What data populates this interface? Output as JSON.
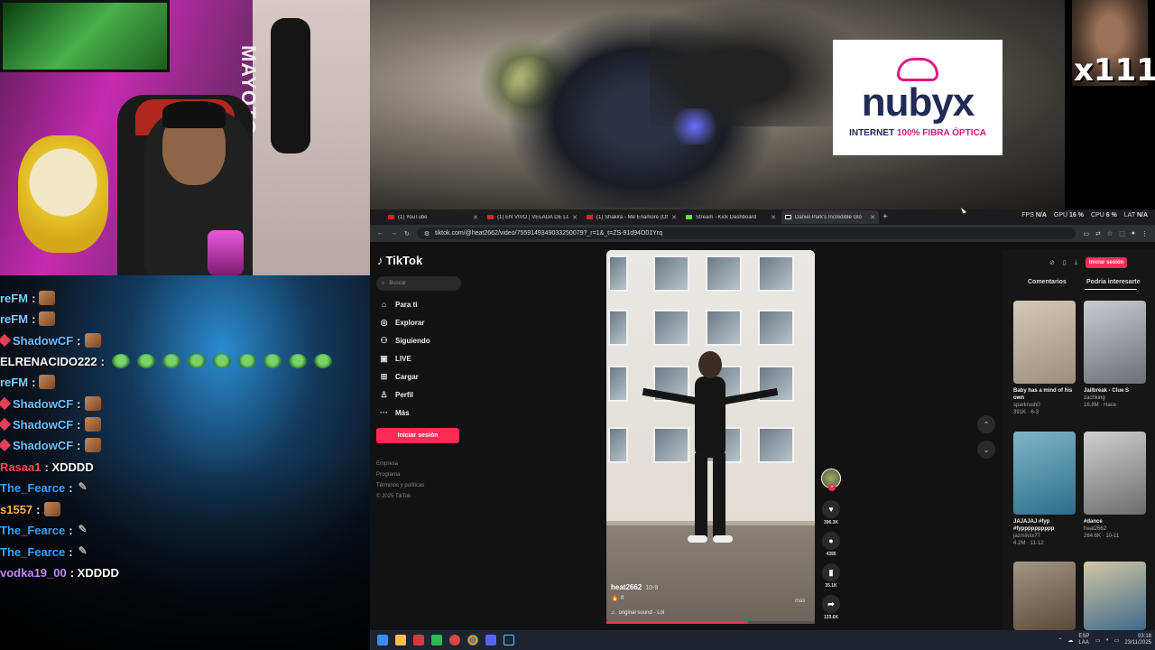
{
  "webcam": {
    "bag_text": "MAYOTO"
  },
  "chat": {
    "lines": [
      {
        "user": "reFM",
        "color": "#7dd0ff",
        "message": ":",
        "emote": "face",
        "badge": false
      },
      {
        "user": "reFM",
        "color": "#7dd0ff",
        "message": ":",
        "emote": "face",
        "badge": false
      },
      {
        "user": "ShadowCF",
        "color": "#6ec0ff",
        "message": ":",
        "emote": "face",
        "badge": true
      },
      {
        "user": "ELRENACIDO222",
        "color": "#ffffff",
        "message": ":",
        "emote": "pepe",
        "badge": false
      },
      {
        "user": "reFM",
        "color": "#7dd0ff",
        "message": ":",
        "emote": "face",
        "badge": false
      },
      {
        "user": "ShadowCF",
        "color": "#6ec0ff",
        "message": ":",
        "emote": "face",
        "badge": true
      },
      {
        "user": "ShadowCF",
        "color": "#6ec0ff",
        "message": ":",
        "emote": "face",
        "badge": true
      },
      {
        "user": "ShadowCF",
        "color": "#6ec0ff",
        "message": ":",
        "emote": "face",
        "badge": true
      },
      {
        "user": "Rasaa1",
        "color": "#ff4a5c",
        "message": ": XDDDD",
        "emote": "",
        "badge": false
      },
      {
        "user": "The_Fearce",
        "color": "#3aa2ff",
        "message": ":",
        "emote": "feather",
        "badge": false
      },
      {
        "user": "s1557",
        "color": "#ffb347",
        "message": ":",
        "emote": "face",
        "badge": false
      },
      {
        "user": "The_Fearce",
        "color": "#3aa2ff",
        "message": ":",
        "emote": "feather",
        "badge": false
      },
      {
        "user": "The_Fearce",
        "color": "#3aa2ff",
        "message": ":",
        "emote": "feather",
        "badge": false
      },
      {
        "user": "vodka19_00",
        "color": "#c08aff",
        "message": ": XDDDD",
        "emote": "",
        "badge": false
      }
    ],
    "pepe_count": 9
  },
  "sponsor": {
    "brand": "nubyx",
    "tagline_prefix": "INTERNET ",
    "tagline_highlight": "100% FIBRA ÓPTICA"
  },
  "corner": {
    "overlay_text": "x111"
  },
  "browser": {
    "tabs": [
      {
        "title": "(1) YouTube",
        "icon": "youtube-icon",
        "active": false
      },
      {
        "title": "(1) EN VIVO | VELADA DE LOS",
        "icon": "youtube-icon",
        "active": false
      },
      {
        "title": "(1) Shakira - Me Enamoré (Offi",
        "icon": "youtube-icon",
        "active": false
      },
      {
        "title": "Stream - Kick Dashboard",
        "icon": "kick-icon",
        "active": false
      },
      {
        "title": "Daniel Park's Incredible Glo",
        "icon": "tiktok-icon",
        "active": true
      }
    ],
    "stats": {
      "fps_label": "FPS",
      "fps": "N/A",
      "gpu_label": "GPU",
      "gpu": "16 %",
      "cpu_label": "CPU",
      "cpu": "6 %",
      "lat_label": "LAT",
      "lat": "N/A"
    },
    "url": "tiktok.com/@heat2662/video/7559149349033250079?_r=1&_t=ZS-91d94O01Yrq"
  },
  "tiktok": {
    "logo": "TikTok",
    "search_placeholder": "Buscar",
    "nav": [
      {
        "label": "Para ti",
        "icon": "home-icon",
        "glyph": "⌂"
      },
      {
        "label": "Explorar",
        "icon": "compass-icon",
        "glyph": "◎"
      },
      {
        "label": "Siguiendo",
        "icon": "following-icon",
        "glyph": "⚇"
      },
      {
        "label": "LIVE",
        "icon": "live-icon",
        "glyph": "▣"
      },
      {
        "label": "Cargar",
        "icon": "upload-icon",
        "glyph": "⊞"
      },
      {
        "label": "Perfil",
        "icon": "profile-icon",
        "glyph": "♙"
      },
      {
        "label": "Más",
        "icon": "more-icon",
        "glyph": "···"
      }
    ],
    "login_label": "Iniciar sesión",
    "footer": [
      "Empresa",
      "Programa",
      "Términos y políticas",
      "© 2025 TikTok"
    ],
    "video": {
      "author": "heat2662",
      "date": "10-9",
      "caption": "#",
      "sound": "original sound - Lol",
      "more_label": "más",
      "progress": 0.68
    },
    "actions": {
      "likes": "396.3K",
      "comments": "4395",
      "saves": "35.1K",
      "shares": "133.6K"
    },
    "right": {
      "login_label": "Iniciar sesión",
      "tab_comments": "Comentarios",
      "tab_suggested": "Podría interesarte",
      "cards": [
        {
          "title": "Baby has a mind of his own",
          "user": "sparkrush0",
          "meta": "391K · 6-3",
          "colors": [
            "#9b8f7a",
            "#d4cab6"
          ]
        },
        {
          "title": "Jailbreak - Clue S",
          "user": "zachking",
          "meta": "16.8M · Hace",
          "colors": [
            "#6b6f74",
            "#c9cdd1"
          ]
        },
        {
          "title": "JAJAJAJ #fyp #fypppppppppp",
          "user": "jazminxx77",
          "meta": "4.2M · 11-12",
          "colors": [
            "#2d6d8a",
            "#7fb6c8"
          ]
        },
        {
          "title": "#dance",
          "user": "heat2662",
          "meta": "264.6K · 10-11",
          "colors": [
            "#6c6c6c",
            "#d0d0d0"
          ]
        },
        {
          "title": "",
          "user": "",
          "meta": "",
          "colors": [
            "#5a4a3a",
            "#a59480"
          ]
        },
        {
          "title": "",
          "user": "",
          "meta": "",
          "colors": [
            "#3f6a8a",
            "#d1c7a5"
          ]
        }
      ]
    }
  },
  "taskbar": {
    "lang": "ESP",
    "layout": "LAA",
    "time": "03:18",
    "date": "23/11/2025"
  }
}
